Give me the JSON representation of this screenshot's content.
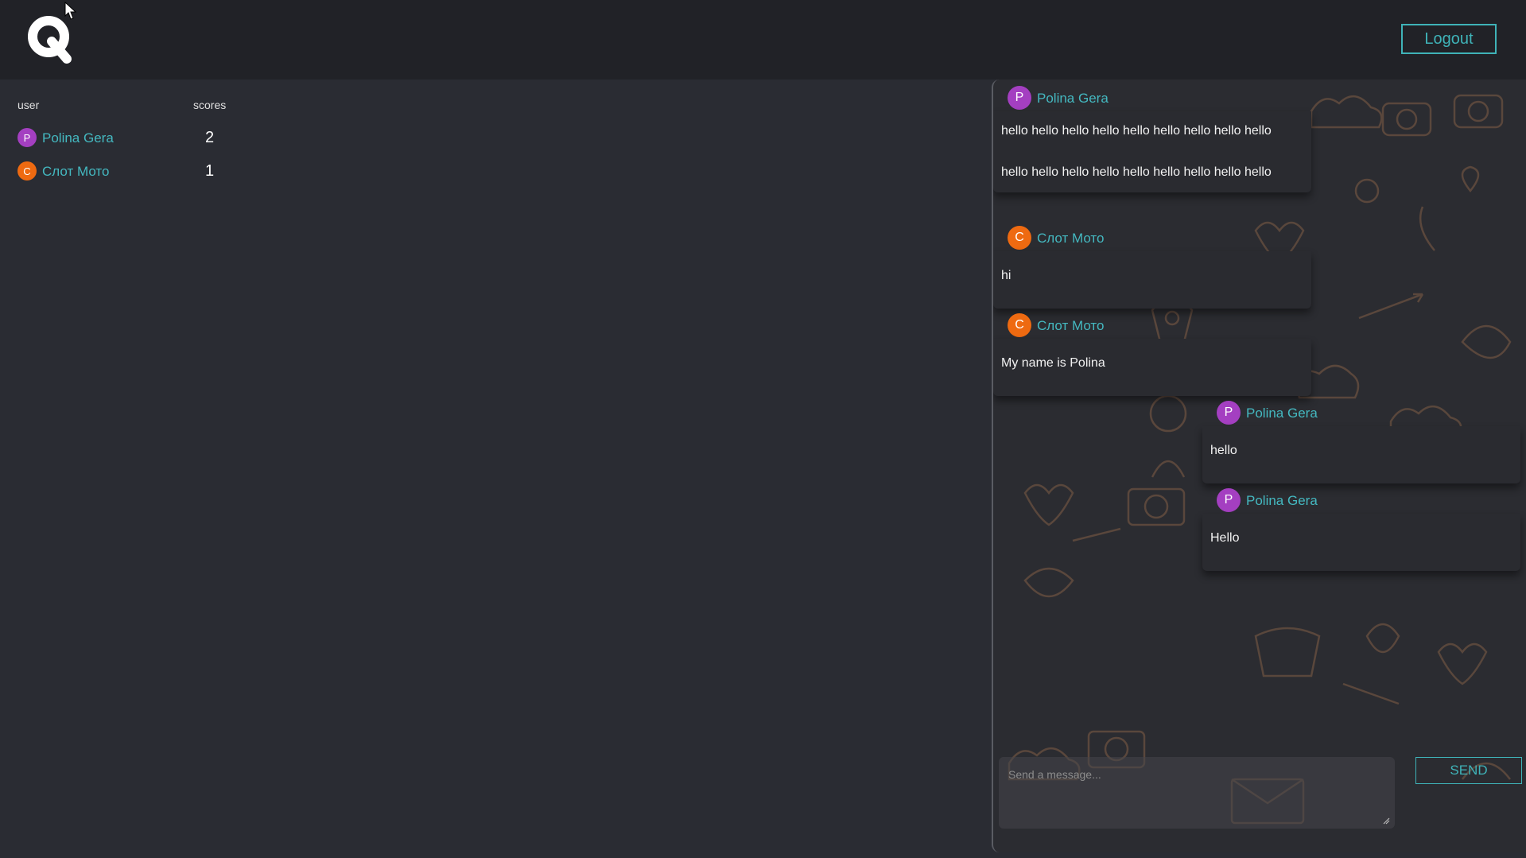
{
  "header": {
    "logo_letter": "Q",
    "logout_label": "Logout"
  },
  "scores": {
    "col_user": "user",
    "col_scores": "scores",
    "rows": [
      {
        "initial": "P",
        "name": "Polina Gera",
        "score": "2",
        "color": "#a43fc1"
      },
      {
        "initial": "С",
        "name": "Слот Мото",
        "score": "1",
        "color": "#ee6a11"
      }
    ]
  },
  "chat": {
    "messages": [
      {
        "initial": "P",
        "author": "Polina Gera",
        "color": "#a43fc1",
        "lines": [
          "hello hello hello hello hello hello hello hello hello",
          "hello hello hello hello hello hello hello hello hello"
        ]
      },
      {
        "initial": "С",
        "author": "Слот Мото",
        "color": "#ee6a11",
        "lines": [
          "hi"
        ]
      },
      {
        "initial": "С",
        "author": "Слот Мото",
        "color": "#ee6a11",
        "lines": [
          "My name is Polina"
        ]
      },
      {
        "initial": "P",
        "author": "Polina Gera",
        "color": "#a43fc1",
        "lines": [
          "hello"
        ]
      },
      {
        "initial": "P",
        "author": "Polina Gera",
        "color": "#a43fc1",
        "lines": [
          "Hello"
        ]
      }
    ],
    "input_placeholder": "Send a message...",
    "send_label": "SEND"
  },
  "colors": {
    "accent": "#3fb3b8",
    "background": "#2a2c33",
    "topbar": "#212227"
  }
}
